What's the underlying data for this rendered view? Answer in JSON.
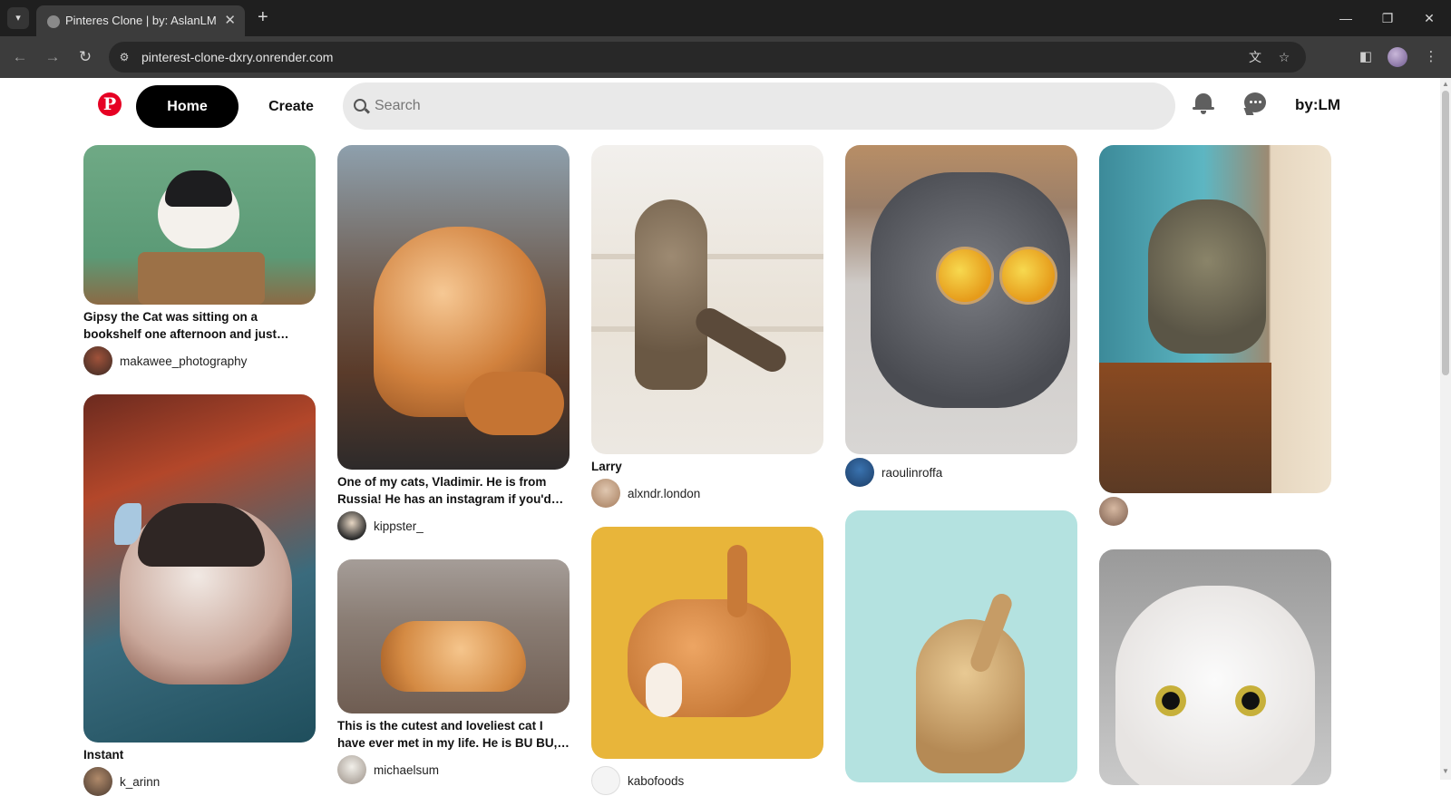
{
  "browser": {
    "tab_title": "Pinteres Clone | by: AslanLM",
    "url": "pinterest-clone-dxry.onrender.com",
    "icons": [
      "tab-list-icon",
      "favicon-icon",
      "close-icon",
      "plus-icon",
      "minimize-icon",
      "restore-icon",
      "close-window-icon",
      "back-icon",
      "forward-icon",
      "reload-icon",
      "site-info-icon",
      "translate-icon",
      "star-icon",
      "sidepanel-icon",
      "profile-avatar",
      "menu-icon"
    ]
  },
  "header": {
    "logo": "P",
    "home_label": "Home",
    "create_label": "Create",
    "search_placeholder": "Search",
    "user_link": "by:LM",
    "brand_color": "#e60023"
  },
  "pins": [
    {
      "title": "Gipsy the Cat was sitting on a bookshelf one afternoon and just stared right at ...",
      "user": "makawee_photography"
    },
    {
      "title": "Instant",
      "user": "k_arinn"
    },
    {
      "title": "One of my cats, Vladimir. He is from Russia! He has an instagram if you'd li...",
      "user": "kippster_"
    },
    {
      "title": "This is the cutest and loveliest cat I have ever met in my life. He is BU BU, a cat ...",
      "user": "michaelsum"
    },
    {
      "title": "Larry",
      "user": "alxndr.london"
    },
    {
      "title": "",
      "user": "kabofoods"
    },
    {
      "title": "",
      "user": "raoulinroffa"
    },
    {
      "title": "",
      "user": ""
    },
    {
      "title": "",
      "user": ""
    }
  ]
}
